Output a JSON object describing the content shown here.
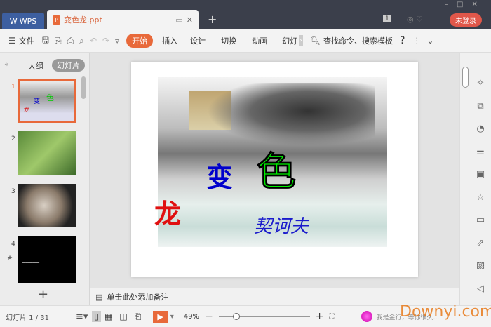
{
  "titlebar": {
    "app_tab": "WPS",
    "doc_tab": "变色龙.ppt",
    "login": "未登录",
    "badge": "1"
  },
  "toolbar": {
    "file": "文件",
    "tabs": [
      "开始",
      "插入",
      "设计",
      "切换",
      "动画",
      "幻灯"
    ],
    "search": "查找命令、搜索模板",
    "help": "?"
  },
  "leftpanel": {
    "outline": "大纲",
    "slides": "幻灯片",
    "thumbs": [
      "1",
      "2",
      "3",
      "4"
    ],
    "add": "+"
  },
  "slide": {
    "chars": [
      "变",
      "色",
      "龙"
    ],
    "author": "契诃夫"
  },
  "notes": {
    "placeholder": "单击此处添加备注"
  },
  "status": {
    "slide_counter": "幻灯片 1 / 31",
    "zoom": "49%",
    "assistant": "我是金行，等你很久...",
    "watermark": "Downyi.com"
  }
}
